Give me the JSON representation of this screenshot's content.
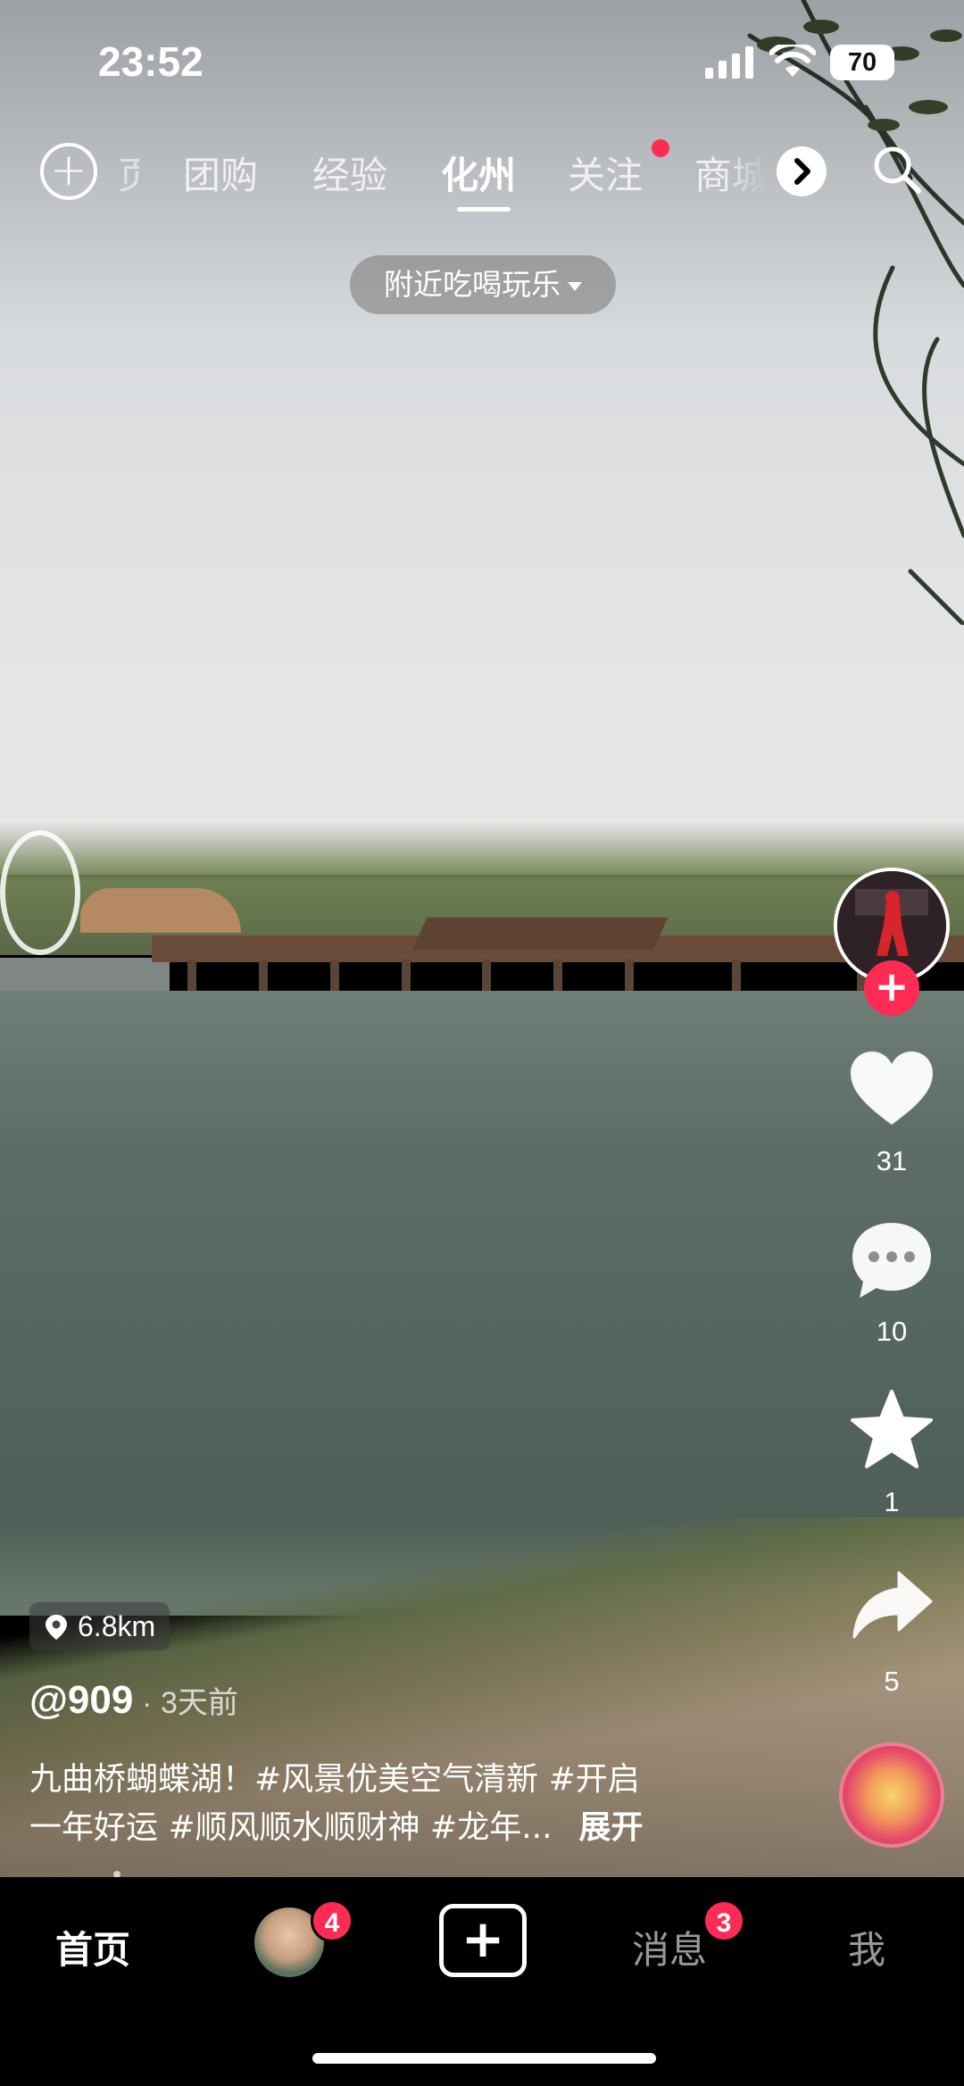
{
  "status_bar": {
    "time": "23:52",
    "battery": "70",
    "icons": [
      "signal-icon",
      "wifi-icon",
      "battery-icon"
    ]
  },
  "top_nav": {
    "partial_left": "页",
    "tabs": [
      {
        "label": "团购",
        "active": false
      },
      {
        "label": "经验",
        "active": false
      },
      {
        "label": "化州",
        "active": true
      },
      {
        "label": "关注",
        "active": false,
        "dot": true
      },
      {
        "label": "商城",
        "active": false
      }
    ],
    "icons": [
      "add-icon",
      "chevron-right-icon",
      "search-icon"
    ]
  },
  "nearby_filter": {
    "label": "附近吃喝玩乐"
  },
  "actions": {
    "likes": "31",
    "comments": "10",
    "favorites": "1",
    "shares": "5"
  },
  "video": {
    "distance": "6.8km",
    "author": "@909",
    "separator": "·",
    "posted": "3天前",
    "caption_line1": "九曲桥蝴蝶湖！#风景优美空气清新 #开启",
    "caption_line2": "一年好运 #顺风顺水顺财神 #龙年...",
    "expand": "展开"
  },
  "bottom_tabs": {
    "home": "首页",
    "friends_badge": "4",
    "messages": "消息",
    "messages_badge": "3",
    "me": "我"
  },
  "colors": {
    "accent": "#fe2c55",
    "tabbar_bg": "#000000"
  }
}
